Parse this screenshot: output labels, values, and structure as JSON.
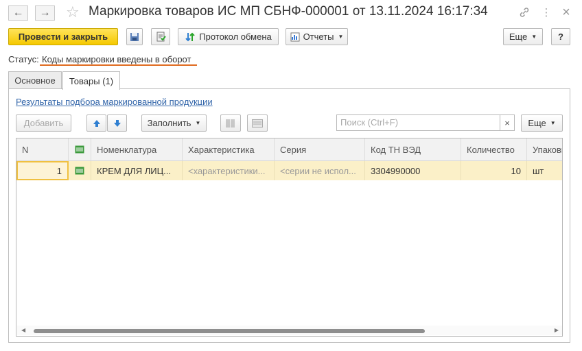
{
  "window": {
    "title": "Маркировка товаров ИС МП СБНФ-000001 от 13.11.2024 16:17:34",
    "back_icon": "←",
    "forward_icon": "→",
    "star_icon": "☆",
    "link_icon": "🔗",
    "menu_icon": "⋮",
    "close_icon": "×"
  },
  "toolbar": {
    "post_close": "Провести и закрыть",
    "exchange_protocol": "Протокол обмена",
    "reports": "Отчеты",
    "more": "Еще",
    "help": "?"
  },
  "status": {
    "label": "Статус:",
    "value": "Коды маркировки введены в оборот"
  },
  "tabs": [
    {
      "label": "Основное"
    },
    {
      "label": "Товары (1)"
    }
  ],
  "goods": {
    "link": "Результаты подбора маркированной продукции",
    "add": "Добавить",
    "fill": "Заполнить",
    "search_placeholder": "Поиск (Ctrl+F)",
    "clear": "×",
    "more": "Еще",
    "columns": [
      "N",
      "",
      "Номенклатура",
      "Характеристика",
      "Серия",
      "Код ТН ВЭД",
      "Количество",
      "Упаковка"
    ],
    "rows": [
      {
        "n": "1",
        "nomenclature": "КРЕМ ДЛЯ ЛИЦ...",
        "characteristic": "<характеристики...",
        "series": "<серии не испол...",
        "tnved": "3304990000",
        "quantity": "10",
        "unit": "шт"
      }
    ]
  },
  "colors": {
    "accent_yellow": "#f5c800",
    "status_underline": "#e06a1f",
    "selected_row": "#fbf0c8",
    "link": "#3366aa"
  }
}
